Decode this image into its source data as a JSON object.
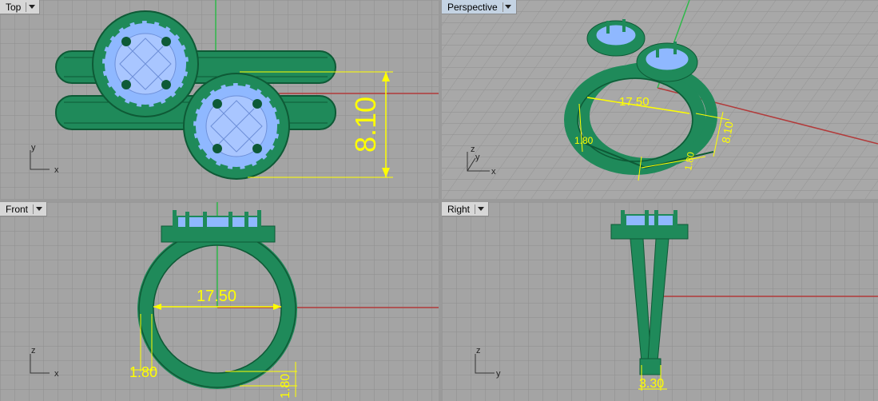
{
  "viewports": {
    "top": {
      "label": "Top"
    },
    "perspective": {
      "label": "Perspective"
    },
    "front": {
      "label": "Front"
    },
    "right": {
      "label": "Right"
    }
  },
  "dimensions": {
    "top_height": "8.10",
    "persp_width": "17.50",
    "persp_height": "8.10",
    "persp_band_left": "1.80",
    "persp_band_bottom": "1.80",
    "front_width": "17.50",
    "front_band_left": "1.80",
    "front_band_bottom": "1.80",
    "right_width": "3.30"
  },
  "axes": {
    "top": {
      "v": "y",
      "h": "x"
    },
    "perspective": {
      "v": "z",
      "h": "x",
      "d": "y"
    },
    "front": {
      "v": "z",
      "h": "x"
    },
    "right": {
      "v": "z",
      "h": "y"
    }
  },
  "colors": {
    "viewport_bg": "#a4a4a4",
    "grid": "#8d8d8d",
    "ring": "#1f8a5a",
    "ring_dark": "#0e5a36",
    "gem": "#8fb8ff",
    "dimension": "#ffff00",
    "x_axis": "#b23a3a",
    "y_axis": "#2fb84a"
  }
}
